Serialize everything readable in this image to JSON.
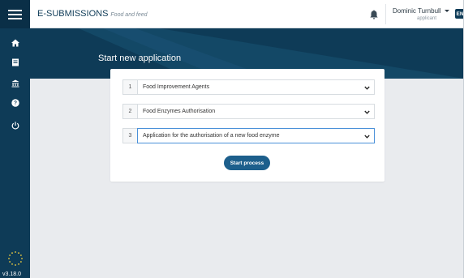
{
  "app": {
    "brand": "E-SUBMISSIONS",
    "section": "Food and feed",
    "version": "v3.18.0"
  },
  "sidebar": {
    "items": [
      {
        "icon": "home-icon"
      },
      {
        "icon": "document-icon"
      },
      {
        "icon": "building-icon"
      },
      {
        "icon": "help-icon"
      },
      {
        "icon": "power-icon"
      }
    ]
  },
  "user": {
    "name": "Dominic Turnbull",
    "role": "applicant",
    "language": "EN"
  },
  "page": {
    "title": "Start new application"
  },
  "form": {
    "steps": [
      {
        "number": "1",
        "value": "Food Improvement Agents"
      },
      {
        "number": "2",
        "value": "Food Enzymes Authorisation"
      },
      {
        "number": "3",
        "value": "Application for the authorisation of a new food enzyme"
      }
    ],
    "start_label": "Start process"
  },
  "colors": {
    "sidebar": "#0e3b57",
    "banner": "#0e3b57",
    "primary_button": "#1d5f8c",
    "background": "#e9ebee"
  }
}
